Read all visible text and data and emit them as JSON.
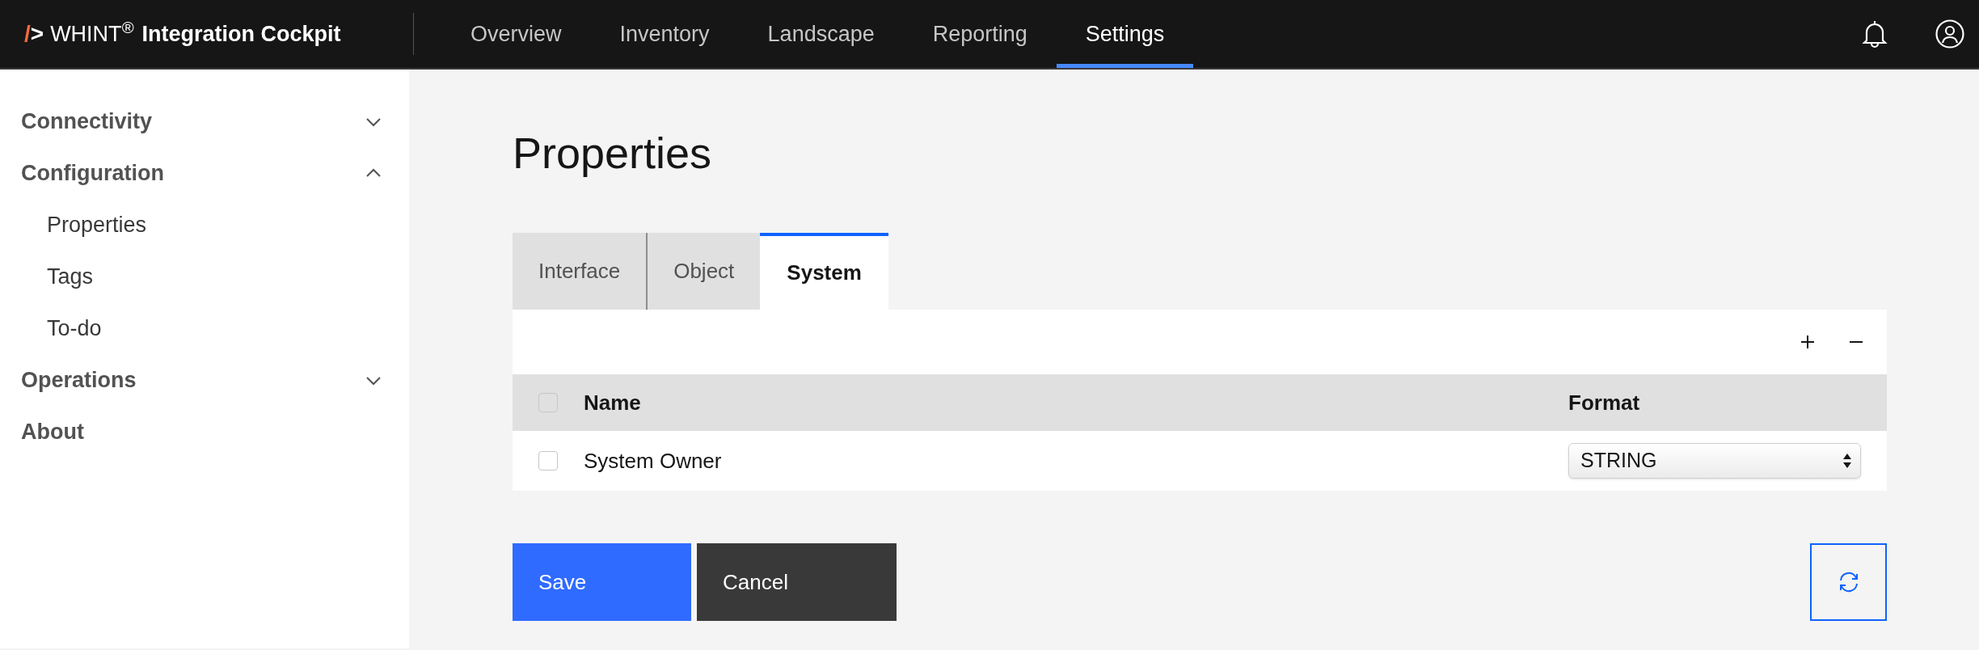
{
  "header": {
    "logo_mark": "/>",
    "brand": "WHINT$^{®}$",
    "product": "Integration Cockpit",
    "nav": [
      {
        "label": "Overview",
        "selected": false
      },
      {
        "label": "Inventory",
        "selected": false
      },
      {
        "label": "Landscape",
        "selected": false
      },
      {
        "label": "Reporting",
        "selected": false
      },
      {
        "label": "Settings",
        "selected": true
      }
    ]
  },
  "sidebar": {
    "items": [
      {
        "label": "Connectivity",
        "expanded": false
      },
      {
        "label": "Configuration",
        "expanded": true,
        "children": [
          {
            "label": "Properties"
          },
          {
            "label": "Tags"
          },
          {
            "label": "To-do"
          }
        ]
      },
      {
        "label": "Operations",
        "expanded": false
      },
      {
        "label": "About"
      }
    ]
  },
  "page": {
    "title": "Properties",
    "tabs": [
      {
        "label": "Interface",
        "selected": false
      },
      {
        "label": "Object",
        "selected": false
      },
      {
        "label": "System",
        "selected": true
      }
    ],
    "table": {
      "select_all_checked": false,
      "columns": [
        "Name",
        "Format"
      ],
      "rows": [
        {
          "checked": false,
          "name": "System Owner",
          "format": "STRING"
        }
      ]
    },
    "buttons": [
      {
        "label": "Save",
        "kind": "primary"
      },
      {
        "label": "Cancel",
        "kind": "secondary"
      }
    ]
  }
}
